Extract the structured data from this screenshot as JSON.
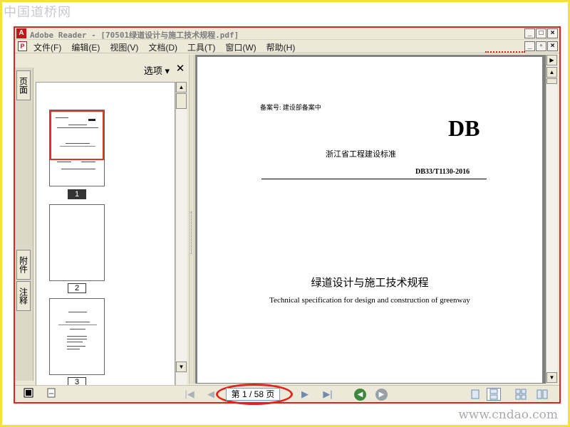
{
  "watermark": {
    "top": "中国道桥网",
    "bottom": "www.cndao.com"
  },
  "window": {
    "title": "Adobe Reader - [70501绿道设计与施工技术规程.pdf]",
    "buttons": [
      "_",
      "□",
      "×"
    ],
    "doc_buttons": [
      "_",
      "▫",
      "×"
    ]
  },
  "menu": {
    "items": [
      "文件(F)",
      "编辑(E)",
      "视图(V)",
      "文档(D)",
      "工具(T)",
      "窗口(W)",
      "帮助(H)"
    ]
  },
  "sidebar": {
    "tabs": [
      "页面",
      "附件",
      "注释"
    ]
  },
  "nav_panel": {
    "options_label": "选项 ▾",
    "close_label": "✕",
    "pages": [
      "1",
      "2",
      "3"
    ],
    "selected_page": "1"
  },
  "document": {
    "filing_no": "备案号:   建设部备案中",
    "db_mark": "DB",
    "standard_name": "浙江省工程建设标准",
    "standard_no": "DB33/T1130-2016",
    "title_zh": "绿道设计与施工技术规程",
    "title_en": "Technical specification for design and construction of greenway"
  },
  "statusbar": {
    "page_indicator": "第 1 / 58 页",
    "first_page": "|◀",
    "prev_page": "◀",
    "next_page": "▶",
    "last_page": "▶|",
    "go_back": "◀",
    "go_forward": "▶"
  },
  "colors": {
    "highlight": "#e0231c",
    "chrome": "#ece9d8",
    "nav_blue": "#6f8cb0",
    "back_green": "#3a8a3a"
  }
}
